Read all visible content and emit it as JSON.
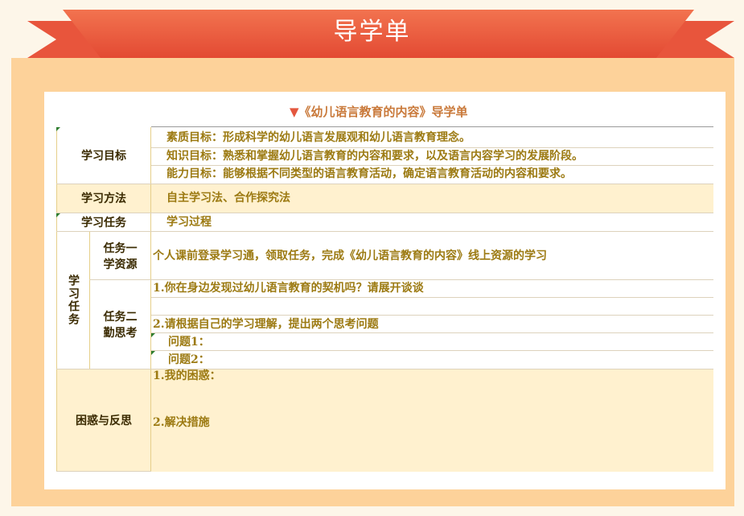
{
  "banner": {
    "title": "导学单"
  },
  "doc": {
    "triangle": "▼",
    "title": "《幼儿语言教育的内容》导学单"
  },
  "rows": {
    "goals": {
      "label": "学习目标",
      "items": [
        "素质目标：形成科学的幼儿语言发展观和幼儿语言教育理念。",
        "知识目标：熟悉和掌握幼儿语言教育的内容和要求，以及语言内容学习的发展阶段。",
        "能力目标：能够根据不同类型的语言教育活动，确定语言教育活动的内容和要求。"
      ]
    },
    "methods": {
      "label": "学习方法",
      "value": "自主学习法、合作探究法"
    },
    "tasks_header": {
      "label": "学习任务",
      "value": "学习过程"
    },
    "tasks": {
      "label": "学习任务",
      "task1": {
        "label_line1": "任务一",
        "label_line2": "学资源",
        "value": "个人课前登录学习通，领取任务，完成《幼儿语言教育的内容》线上资源的学习"
      },
      "task2": {
        "label_line1": "任务二",
        "label_line2": "勤思考",
        "q1": "1.你在身边发现过幼儿语言教育的契机吗？请展开谈谈",
        "q2": "2.请根据自己的学习理解，提出两个思考问题",
        "p1": "问题1：",
        "p2": "问题2："
      }
    },
    "reflection": {
      "label": "困惑与反思",
      "item1": "1.我的困惑：",
      "item2": "2.解决措施"
    }
  }
}
